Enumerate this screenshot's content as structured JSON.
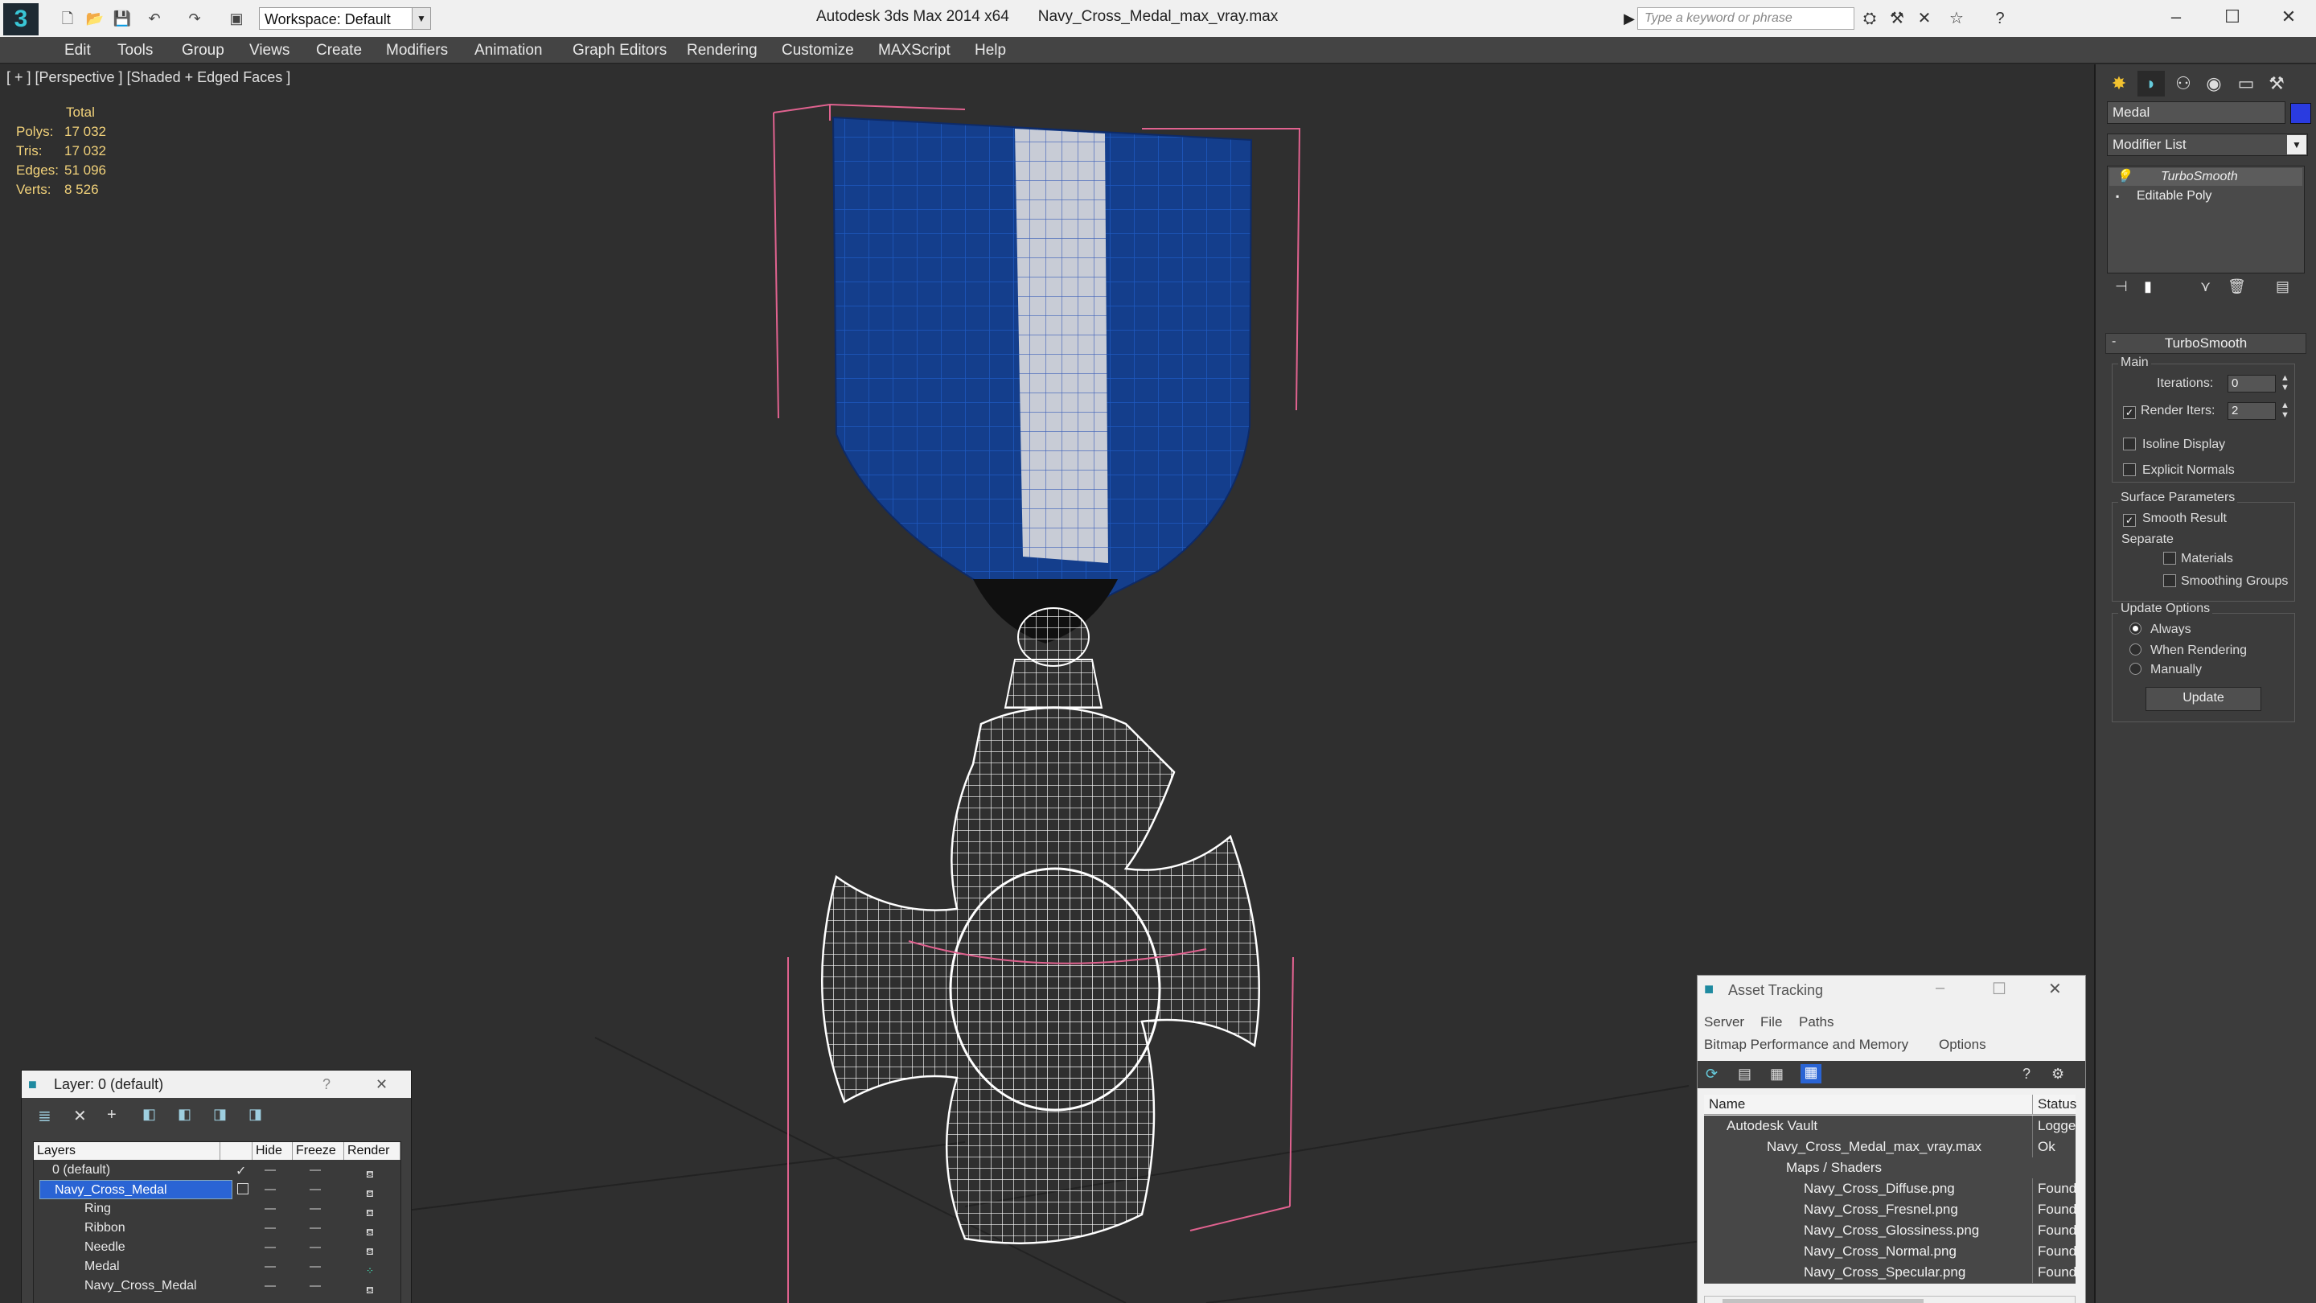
{
  "window": {
    "app_title": "Autodesk 3ds Max  2014 x64",
    "file_title": "Navy_Cross_Medal_max_vray.max",
    "workspace": "Workspace: Default",
    "search_placeholder": "Type a keyword or phrase"
  },
  "menu": [
    "Edit",
    "Tools",
    "Group",
    "Views",
    "Create",
    "Modifiers",
    "Animation",
    "Graph Editors",
    "Rendering",
    "Customize",
    "MAXScript",
    "Help"
  ],
  "viewport": {
    "label": "[ + ] [Perspective ] [Shaded + Edged Faces ]",
    "stats_header": "Total",
    "stats": [
      {
        "label": "Polys:",
        "value": "17 032"
      },
      {
        "label": "Tris:",
        "value": "17 032"
      },
      {
        "label": "Edges:",
        "value": "51 096"
      },
      {
        "label": "Verts:",
        "value": "8 526"
      }
    ]
  },
  "command_panel": {
    "object_name": "Medal",
    "object_color": "#2a3be0",
    "modifier_list": "Modifier List",
    "stack": [
      "TurboSmooth",
      "Editable Poly"
    ],
    "rollout": "TurboSmooth",
    "main_group": "Main",
    "iterations_label": "Iterations:",
    "iterations_value": "0",
    "render_iters_label": "Render Iters:",
    "render_iters_value": "2",
    "isoline": "Isoline Display",
    "explicit_normals": "Explicit Normals",
    "surface_group": "Surface Parameters",
    "smooth_result": "Smooth Result",
    "separate": "Separate",
    "materials": "Materials",
    "smoothing_groups": "Smoothing Groups",
    "update_group": "Update Options",
    "always": "Always",
    "when_rendering": "When Rendering",
    "manually": "Manually",
    "update_button": "Update"
  },
  "layer_dialog": {
    "title": "Layer: 0 (default)",
    "help": "?",
    "columns": [
      "Layers",
      "Hide",
      "Freeze",
      "Render"
    ],
    "rows": [
      {
        "name": "0 (default)",
        "indent": 0,
        "selected": false
      },
      {
        "name": "Navy_Cross_Medal",
        "indent": 0,
        "selected": true
      },
      {
        "name": "Ring",
        "indent": 1,
        "selected": false
      },
      {
        "name": "Ribbon",
        "indent": 1,
        "selected": false
      },
      {
        "name": "Needle",
        "indent": 1,
        "selected": false
      },
      {
        "name": "Medal",
        "indent": 1,
        "selected": false
      },
      {
        "name": "Navy_Cross_Medal",
        "indent": 1,
        "selected": false
      }
    ]
  },
  "asset_dialog": {
    "title": "Asset Tracking",
    "menu": [
      "Server",
      "File",
      "Paths"
    ],
    "menu2": [
      "Bitmap Performance and Memory",
      "Options"
    ],
    "columns": [
      "Name",
      "Status"
    ],
    "rows": [
      {
        "name": "Autodesk Vault",
        "status": "Logged",
        "indent": 0
      },
      {
        "name": "Navy_Cross_Medal_max_vray.max",
        "status": "Ok",
        "indent": 1
      },
      {
        "name": "Maps / Shaders",
        "status": "",
        "indent": 2
      },
      {
        "name": "Navy_Cross_Diffuse.png",
        "status": "Found",
        "indent": 3
      },
      {
        "name": "Navy_Cross_Fresnel.png",
        "status": "Found",
        "indent": 3
      },
      {
        "name": "Navy_Cross_Glossiness.png",
        "status": "Found",
        "indent": 3
      },
      {
        "name": "Navy_Cross_Normal.png",
        "status": "Found",
        "indent": 3
      },
      {
        "name": "Navy_Cross_Specular.png",
        "status": "Found",
        "indent": 3
      }
    ]
  }
}
